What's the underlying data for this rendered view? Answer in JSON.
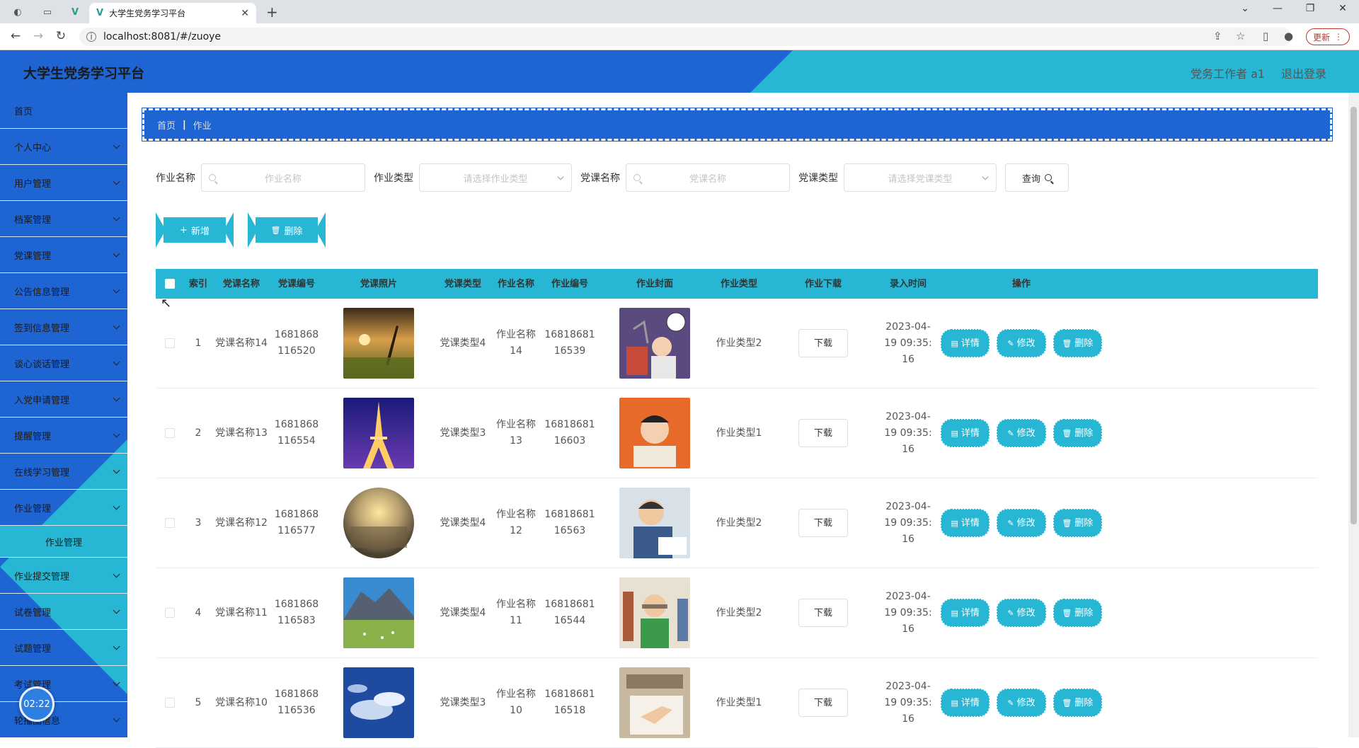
{
  "browser": {
    "tab_title": "大学生党务学习平台",
    "url": "localhost:8081/#/zuoye",
    "update_label": "更新"
  },
  "header": {
    "title": "大学生党务学习平台",
    "user": "党务工作者 a1",
    "logout": "退出登录"
  },
  "sidebar": {
    "items": [
      {
        "label": "首页",
        "has_chevron": false
      },
      {
        "label": "个人中心",
        "has_chevron": true
      },
      {
        "label": "用户管理",
        "has_chevron": true
      },
      {
        "label": "档案管理",
        "has_chevron": true
      },
      {
        "label": "党课管理",
        "has_chevron": true
      },
      {
        "label": "公告信息管理",
        "has_chevron": true
      },
      {
        "label": "签到信息管理",
        "has_chevron": true
      },
      {
        "label": "谈心谈话管理",
        "has_chevron": true
      },
      {
        "label": "入党申请管理",
        "has_chevron": true
      },
      {
        "label": "提醒管理",
        "has_chevron": true
      },
      {
        "label": "在线学习管理",
        "has_chevron": true
      },
      {
        "label": "作业管理",
        "has_chevron": true
      }
    ],
    "active_sub": "作业管理",
    "items_after": [
      {
        "label": "作业提交管理"
      },
      {
        "label": "试卷管理"
      },
      {
        "label": "试题管理"
      },
      {
        "label": "考试管理"
      },
      {
        "label": "轮播图信息"
      }
    ],
    "timer": "02:22"
  },
  "breadcrumb": {
    "home": "首页",
    "current": "作业"
  },
  "search": {
    "zuoye_name_label": "作业名称",
    "zuoye_name_placeholder": "作业名称",
    "zuoye_type_label": "作业类型",
    "zuoye_type_placeholder": "请选择作业类型",
    "dangke_name_label": "党课名称",
    "dangke_name_placeholder": "党课名称",
    "dangke_type_label": "党课类型",
    "dangke_type_placeholder": "请选择党课类型",
    "query_label": "查询"
  },
  "actions": {
    "add": "新增",
    "delete": "删除"
  },
  "table": {
    "columns": [
      "索引",
      "党课名称",
      "党课编号",
      "党课照片",
      "党课类型",
      "作业名称",
      "作业编号",
      "作业封面",
      "作业类型",
      "作业下载",
      "录入时间",
      "操作"
    ],
    "download_label": "下载",
    "op_detail": "详情",
    "op_edit": "修改",
    "op_delete": "删除",
    "rows": [
      {
        "index": "1",
        "dangke_name": "党课名称14",
        "dangke_no": "1681868116520",
        "dangke_type": "党课类型4",
        "zuoye_name": "作业名称14",
        "zuoye_no": "1681868116539",
        "zuoye_type": "作业类型2",
        "time": "2023-04-19 09:35:16",
        "photo": "sunset-field",
        "cover": "student-lamp"
      },
      {
        "index": "2",
        "dangke_name": "党课名称13",
        "dangke_no": "1681868116554",
        "dangke_type": "党课类型3",
        "zuoye_name": "作业名称13",
        "zuoye_no": "1681868116603",
        "zuoye_type": "作业类型1",
        "time": "2023-04-19 09:35:16",
        "photo": "eiffel-tower",
        "cover": "stressed-student"
      },
      {
        "index": "3",
        "dangke_name": "党课名称12",
        "dangke_no": "1681868116577",
        "dangke_type": "党课类型4",
        "zuoye_name": "作业名称12",
        "zuoye_no": "1681868116563",
        "zuoye_type": "作业类型2",
        "time": "2023-04-19 09:35:16",
        "photo": "sunset-fisheye",
        "cover": "boy-writing"
      },
      {
        "index": "4",
        "dangke_name": "党课名称11",
        "dangke_no": "1681868116583",
        "dangke_type": "党课类型4",
        "zuoye_name": "作业名称11",
        "zuoye_no": "1681868116544",
        "zuoye_type": "作业类型2",
        "time": "2023-04-19 09:35:16",
        "photo": "mountain-meadow",
        "cover": "boy-books"
      },
      {
        "index": "5",
        "dangke_name": "党课名称10",
        "dangke_no": "1681868116536",
        "dangke_type": "党课类型3",
        "zuoye_name": "作业名称10",
        "zuoye_no": "1681868116518",
        "zuoye_type": "作业类型1",
        "time": "2023-04-19 09:35:16",
        "photo": "blue-sky-clouds",
        "cover": "hand-writing"
      }
    ]
  }
}
